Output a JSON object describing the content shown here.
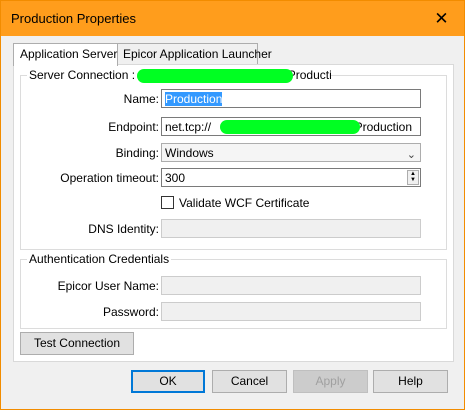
{
  "window": {
    "title": "Production Properties",
    "close_glyph": "✕"
  },
  "tabs": [
    {
      "label": "Application Server",
      "active": true
    },
    {
      "label": "Epicor Application Launcher",
      "active": false
    }
  ],
  "server_connection": {
    "title_prefix": "Server Connection :",
    "title_suffix": "Production",
    "name_label": "Name:",
    "name_value": "Production",
    "endpoint_label": "Endpoint:",
    "endpoint_prefix": "net.tcp://",
    "endpoint_suffix": "Production",
    "binding_label": "Binding:",
    "binding_value": "Windows",
    "timeout_label": "Operation timeout:",
    "timeout_value": "300",
    "validate_label": "Validate WCF Certificate",
    "dns_label": "DNS Identity:",
    "dns_value": ""
  },
  "auth": {
    "title": "Authentication Credentials",
    "user_label": "Epicor User Name:",
    "user_value": "",
    "password_label": "Password:",
    "password_value": ""
  },
  "buttons": {
    "test": "Test Connection",
    "ok": "OK",
    "cancel": "Cancel",
    "apply": "Apply",
    "help": "Help"
  },
  "colors": {
    "titlebar": "#ff9d1c",
    "redaction": "#00ff22",
    "selection": "#3399ff"
  }
}
